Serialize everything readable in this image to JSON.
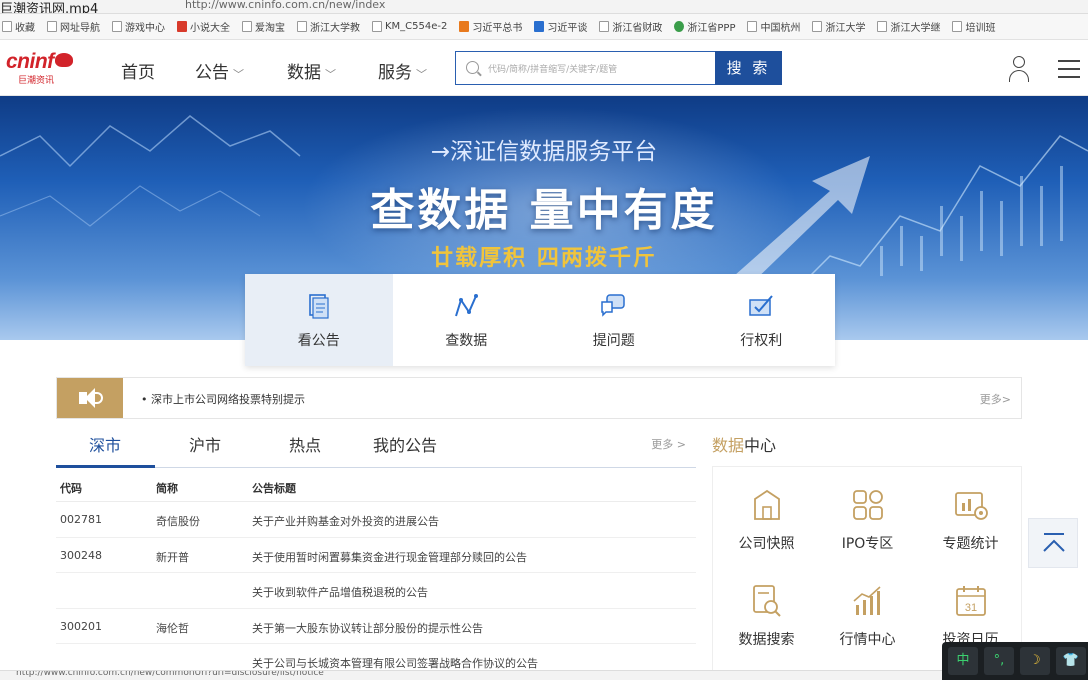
{
  "browser": {
    "video_title": "巨潮资讯网.mp4",
    "url": "http://www.cninfo.com.cn/new/index",
    "bookmarks": [
      {
        "label": "收藏",
        "icon": "star-icon"
      },
      {
        "label": "网址导航",
        "icon": "globe-icon"
      },
      {
        "label": "游戏中心",
        "icon": "page-icon"
      },
      {
        "label": "小说大全",
        "icon": "red-app-icon"
      },
      {
        "label": "爱淘宝",
        "icon": "page-icon"
      },
      {
        "label": "浙江大学教",
        "icon": "page-icon"
      },
      {
        "label": "KM_C554e-2",
        "icon": "page-icon"
      },
      {
        "label": "习近平总书",
        "icon": "orange-app-icon"
      },
      {
        "label": "习近平谈",
        "icon": "blue-app-icon"
      },
      {
        "label": "浙江省财政",
        "icon": "page-icon"
      },
      {
        "label": "浙江省PPP",
        "icon": "green-app-icon"
      },
      {
        "label": "中国杭州",
        "icon": "page-icon"
      },
      {
        "label": "浙江大学",
        "icon": "page-icon"
      },
      {
        "label": "浙江大学继",
        "icon": "page-icon"
      },
      {
        "label": "培训班",
        "icon": "page-icon"
      }
    ],
    "status_url": "http://www.cninfo.com.cn/new/commonUrl?url=disclosure/list/notice"
  },
  "header": {
    "logo_en": "cninf",
    "logo_cn": "巨潮资讯",
    "nav": [
      {
        "label": "首页",
        "has_dropdown": false
      },
      {
        "label": "公告",
        "has_dropdown": true
      },
      {
        "label": "数据",
        "has_dropdown": true
      },
      {
        "label": "服务",
        "has_dropdown": true
      }
    ],
    "search_placeholder": "代码/简称/拼音缩写/关键字/题管",
    "search_button": "搜 索"
  },
  "banner": {
    "subtitle": "→深证信数据服务平台",
    "headline": "查数据 量中有度",
    "slogan": "廿载厚积 四两拨千斤"
  },
  "tiles": [
    {
      "label": "看公告",
      "icon": "document-icon",
      "active": true
    },
    {
      "label": "查数据",
      "icon": "chart-line-icon",
      "active": false
    },
    {
      "label": "提问题",
      "icon": "chat-bubble-icon",
      "active": false
    },
    {
      "label": "行权利",
      "icon": "vote-check-icon",
      "active": false
    }
  ],
  "notice": {
    "text": "• 深市上市公司网络投票特别提示",
    "more": "更多>"
  },
  "announcements": {
    "tabs": [
      "深市",
      "沪市",
      "热点",
      "我的公告"
    ],
    "active_tab": "深市",
    "more": "更多 >",
    "columns": [
      "代码",
      "简称",
      "公告标题"
    ],
    "rows": [
      {
        "code": "002781",
        "name": "奇信股份",
        "title": "关于产业并购基金对外投资的进展公告"
      },
      {
        "code": "300248",
        "name": "新开普",
        "title": "关于使用暂时闲置募集资金进行现金管理部分赎回的公告"
      },
      {
        "code": "",
        "name": "",
        "title": "关于收到软件产品增值税退税的公告"
      },
      {
        "code": "300201",
        "name": "海伦哲",
        "title": "关于第一大股东协议转让部分股份的提示性公告"
      },
      {
        "code": "",
        "name": "",
        "title": "关于公司与长城资本管理有限公司签署战略合作协议的公告"
      }
    ]
  },
  "data_center": {
    "title_highlight": "数据",
    "title_rest": "中心",
    "items": [
      {
        "label": "公司快照",
        "icon": "company-icon"
      },
      {
        "label": "IPO专区",
        "icon": "grid-icon"
      },
      {
        "label": "专题统计",
        "icon": "stats-icon"
      },
      {
        "label": "数据搜索",
        "icon": "search-doc-icon"
      },
      {
        "label": "行情中心",
        "icon": "bar-chart-icon"
      },
      {
        "label": "投资日历",
        "icon": "calendar-icon"
      }
    ],
    "calendar_day": "31"
  },
  "ime": [
    "中",
    "°,",
    "☽",
    "👕"
  ],
  "colors": {
    "brand_red": "#d2232a",
    "nav_blue": "#1e4f9c",
    "gold": "#c4a062",
    "slogan_yellow": "#f0c43c"
  }
}
